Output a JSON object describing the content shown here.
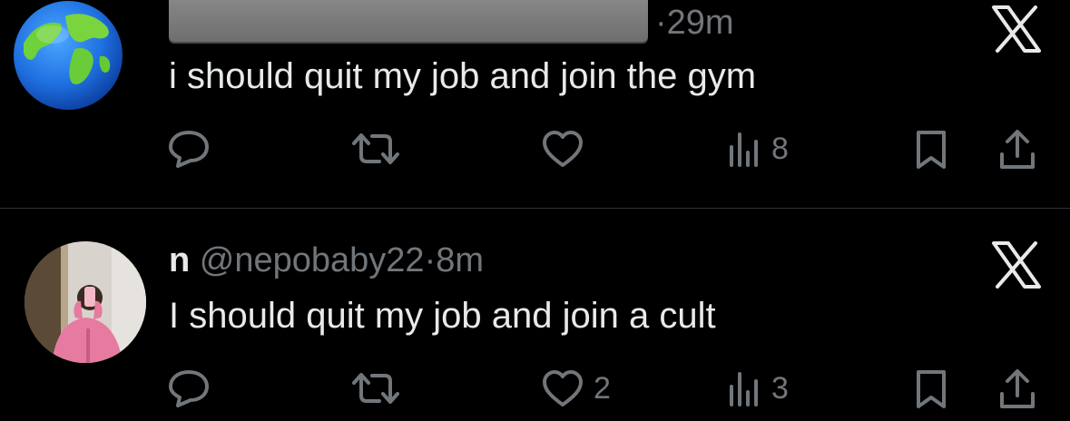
{
  "colors": {
    "background": "#000000",
    "text_primary": "#e7e9ea",
    "text_secondary": "#71767b",
    "divider": "#2f3336"
  },
  "tweets": [
    {
      "author_name": "",
      "author_handle": "",
      "time": "29m",
      "text": "i should quit my job and join the gym",
      "avatar": "earth-globe",
      "name_redacted": true,
      "replies": "",
      "reposts": "",
      "likes": "",
      "views": "8"
    },
    {
      "author_name": "n",
      "author_handle": "@nepobaby22",
      "time": "8m",
      "text": "I should quit my job and join a cult",
      "avatar": "person-photo",
      "name_redacted": false,
      "replies": "",
      "reposts": "",
      "likes": "2",
      "views": "3"
    }
  ],
  "icons": {
    "reply": "reply-icon",
    "repost": "repost-icon",
    "like": "like-icon",
    "views": "views-icon",
    "bookmark": "bookmark-icon",
    "share": "share-icon",
    "brand": "x-logo-icon"
  },
  "separator": "·"
}
